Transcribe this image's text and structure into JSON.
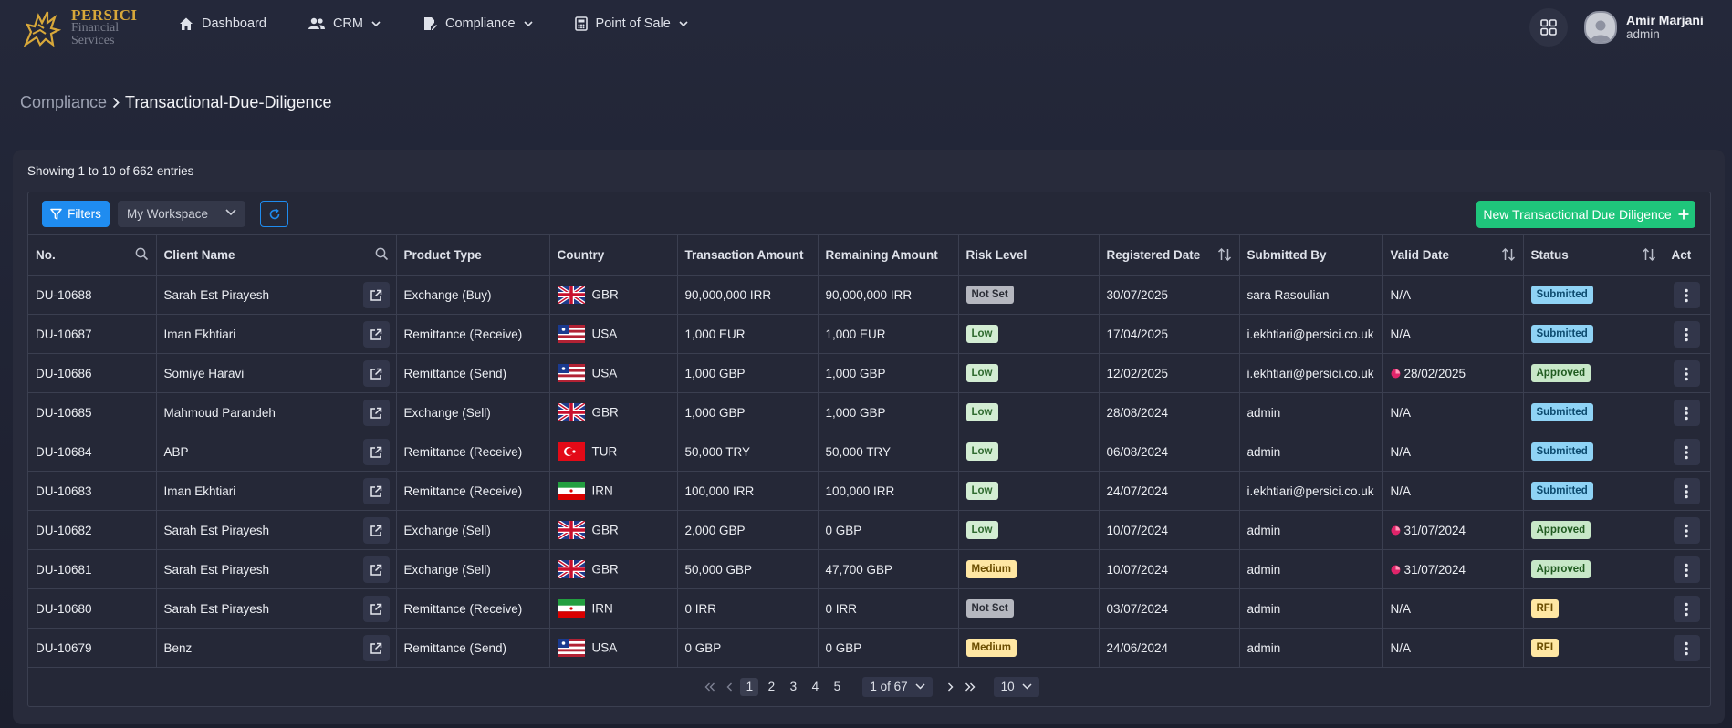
{
  "brand": {
    "line1": "PERSICI",
    "line2": "Financial",
    "line3": "Services",
    "gold": "#d8a83a"
  },
  "nav": [
    {
      "label": "Dashboard",
      "icon": "home-icon"
    },
    {
      "label": "CRM",
      "icon": "users-icon"
    },
    {
      "label": "Compliance",
      "icon": "document-edit-icon"
    },
    {
      "label": "Point of Sale",
      "icon": "calculator-icon"
    }
  ],
  "user": {
    "name": "Amir Marjani",
    "role": "admin"
  },
  "breadcrumb": {
    "parent": "Compliance",
    "current": "Transactional-Due-Diligence"
  },
  "summary": "Showing 1 to 10 of 662 entries",
  "toolbar": {
    "filters_label": "Filters",
    "workspace_value": "My Workspace",
    "new_label": "New Transactional Due Diligence"
  },
  "columns": [
    "No.",
    "Client Name",
    "Product Type",
    "Country",
    "Transaction Amount",
    "Remaining Amount",
    "Risk Level",
    "Registered Date",
    "Submitted By",
    "Valid Date",
    "Status",
    "Act"
  ],
  "rows": [
    {
      "no": "DU-10688",
      "client": "Sarah Est Pirayesh",
      "product": "Exchange (Buy)",
      "country": "GBR",
      "tx": "90,000,000 IRR",
      "rem": "90,000,000 IRR",
      "risk": "Not Set",
      "reg": "30/07/2025",
      "by": "sara Rasoulian",
      "valid": "N/A",
      "valid_warn": false,
      "status": "Submitted"
    },
    {
      "no": "DU-10687",
      "client": "Iman Ekhtiari",
      "product": "Remittance (Receive)",
      "country": "USA",
      "tx": "1,000 EUR",
      "rem": "1,000 EUR",
      "risk": "Low",
      "reg": "17/04/2025",
      "by": "i.ekhtiari@persici.co.uk",
      "valid": "N/A",
      "valid_warn": false,
      "status": "Submitted"
    },
    {
      "no": "DU-10686",
      "client": "Somiye Haravi",
      "product": "Remittance (Send)",
      "country": "USA",
      "tx": "1,000 GBP",
      "rem": "1,000 GBP",
      "risk": "Low",
      "reg": "12/02/2025",
      "by": "i.ekhtiari@persici.co.uk",
      "valid": "28/02/2025",
      "valid_warn": true,
      "status": "Approved"
    },
    {
      "no": "DU-10685",
      "client": "Mahmoud Parandeh",
      "product": "Exchange (Sell)",
      "country": "GBR",
      "tx": "1,000 GBP",
      "rem": "1,000 GBP",
      "risk": "Low",
      "reg": "28/08/2024",
      "by": "admin",
      "valid": "N/A",
      "valid_warn": false,
      "status": "Submitted"
    },
    {
      "no": "DU-10684",
      "client": "ABP",
      "product": "Remittance (Receive)",
      "country": "TUR",
      "tx": "50,000 TRY",
      "rem": "50,000 TRY",
      "risk": "Low",
      "reg": "06/08/2024",
      "by": "admin",
      "valid": "N/A",
      "valid_warn": false,
      "status": "Submitted"
    },
    {
      "no": "DU-10683",
      "client": "Iman Ekhtiari",
      "product": "Remittance (Receive)",
      "country": "IRN",
      "tx": "100,000 IRR",
      "rem": "100,000 IRR",
      "risk": "Low",
      "reg": "24/07/2024",
      "by": "i.ekhtiari@persici.co.uk",
      "valid": "N/A",
      "valid_warn": false,
      "status": "Submitted"
    },
    {
      "no": "DU-10682",
      "client": "Sarah Est Pirayesh",
      "product": "Exchange (Sell)",
      "country": "GBR",
      "tx": "2,000 GBP",
      "rem": "0 GBP",
      "risk": "Low",
      "reg": "10/07/2024",
      "by": "admin",
      "valid": "31/07/2024",
      "valid_warn": true,
      "status": "Approved"
    },
    {
      "no": "DU-10681",
      "client": "Sarah Est Pirayesh",
      "product": "Exchange (Sell)",
      "country": "GBR",
      "tx": "50,000 GBP",
      "rem": "47,700 GBP",
      "risk": "Medium",
      "reg": "10/07/2024",
      "by": "admin",
      "valid": "31/07/2024",
      "valid_warn": true,
      "status": "Approved"
    },
    {
      "no": "DU-10680",
      "client": "Sarah Est Pirayesh",
      "product": "Remittance (Receive)",
      "country": "IRN",
      "tx": "0 IRR",
      "rem": "0 IRR",
      "risk": "Not Set",
      "reg": "03/07/2024",
      "by": "admin",
      "valid": "N/A",
      "valid_warn": false,
      "status": "RFI"
    },
    {
      "no": "DU-10679",
      "client": "Benz",
      "product": "Remittance (Send)",
      "country": "USA",
      "tx": "0 GBP",
      "rem": "0 GBP",
      "risk": "Medium",
      "reg": "24/06/2024",
      "by": "admin",
      "valid": "N/A",
      "valid_warn": false,
      "status": "RFI"
    }
  ],
  "pagination": {
    "pages": [
      "1",
      "2",
      "3",
      "4",
      "5"
    ],
    "current": "1",
    "page_of": "1 of 67",
    "page_size": "10"
  },
  "colors": {
    "primary": "#1f8cf0",
    "success": "#1fc57b",
    "warning_dot": "#e0246a"
  }
}
